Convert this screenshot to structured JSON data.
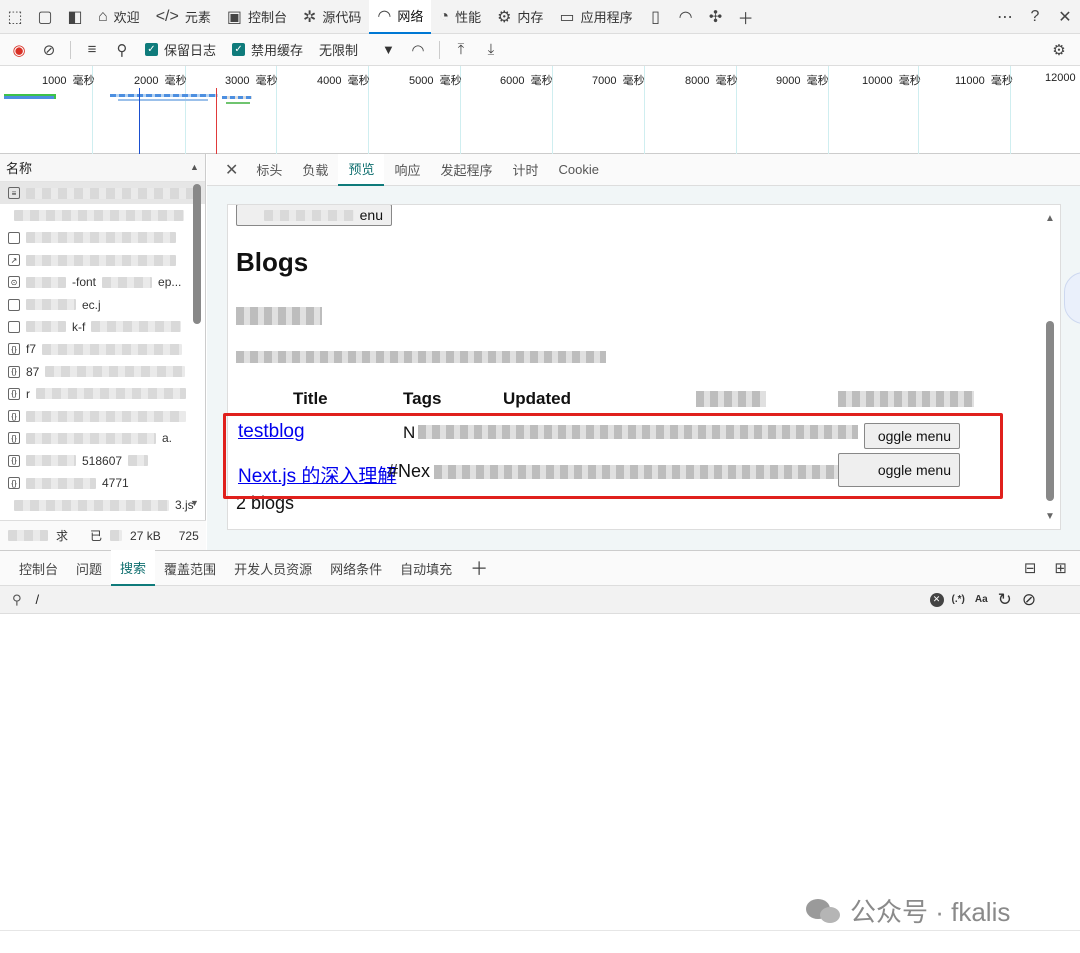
{
  "tabbar": {
    "tabs": [
      {
        "label": "欢迎",
        "icon": "home-icon"
      },
      {
        "label": "元素",
        "icon": "code-icon"
      },
      {
        "label": "控制台",
        "icon": "console-icon"
      },
      {
        "label": "源代码",
        "icon": "bug-icon"
      },
      {
        "label": "网络",
        "icon": "wifi-icon"
      },
      {
        "label": "性能",
        "icon": "gauge-icon"
      },
      {
        "label": "内存",
        "icon": "chip-icon"
      },
      {
        "label": "应用程序",
        "icon": "app-icon"
      }
    ],
    "active": "网络"
  },
  "toolbar": {
    "preserve_log": "保留日志",
    "disable_cache": "禁用缓存",
    "throttle": "无限制"
  },
  "overview": {
    "unit": "毫秒",
    "ticks": [
      "1000",
      "2000",
      "3000",
      "4000",
      "5000",
      "6000",
      "7000",
      "8000",
      "9000",
      "10000",
      "11000",
      "12000"
    ]
  },
  "requests": {
    "header": "名称",
    "items": [
      "",
      "",
      "",
      "",
      "-font",
      "ec.j",
      "k-f",
      "f7",
      "87",
      "r",
      "",
      "a.",
      "518607",
      "4771",
      "3.js"
    ],
    "status": {
      "a": "求",
      "b": "已",
      "size": "27 kB",
      "c": "725"
    }
  },
  "details": {
    "tabs": [
      "标头",
      "负载",
      "预览",
      "响应",
      "发起程序",
      "计时",
      "Cookie"
    ],
    "active": "预览"
  },
  "preview": {
    "top_button": "enu",
    "heading": "Blogs",
    "table_headers": [
      "Title",
      "Tags",
      "Updated"
    ],
    "rows": [
      {
        "title": "testblog",
        "tag": "N",
        "menu": "oggle menu"
      },
      {
        "title": "Next.js 的深入理解",
        "tag": "#Nex",
        "menu": "oggle menu"
      }
    ],
    "count": "2 blogs"
  },
  "drawer": {
    "tabs": [
      "控制台",
      "问题",
      "搜索",
      "覆盖范围",
      "开发人员资源",
      "网络条件",
      "自动填充"
    ],
    "active": "搜索",
    "search_value": "/",
    "regex_label": "(.*)",
    "case_label": "Aa"
  },
  "watermark": {
    "text": "公众号 · fkalis"
  },
  "colors": {
    "accent": "#0f7b7b",
    "tab_underline": "#0078d4",
    "highlight": "#e0201c",
    "link": "#0000ee"
  }
}
